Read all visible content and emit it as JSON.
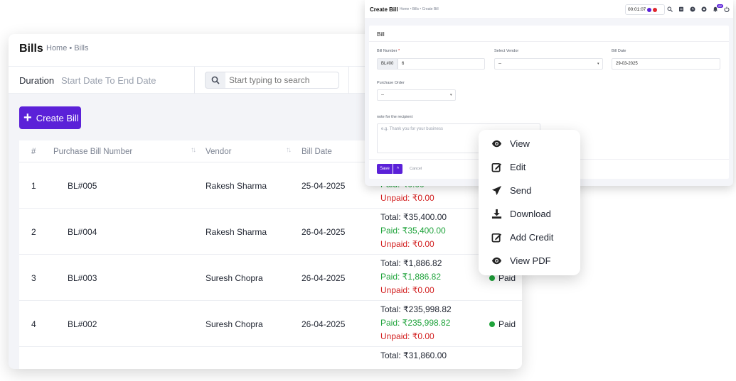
{
  "bills_page": {
    "title": "Bills",
    "breadcrumb": "Home • Bills",
    "duration_label": "Duration",
    "duration_placeholder": "Start Date To End Date",
    "search_placeholder": "Start typing to search",
    "create_button": "Create Bill",
    "columns": [
      "#",
      "Purchase Bill Number",
      "Vendor",
      "Bill Date"
    ],
    "rows": [
      {
        "num": "1",
        "bill": "BL#005",
        "vendor": "Rakesh Sharma",
        "date": "25-04-2025",
        "total": "",
        "paid": "Paid: ₹0.00",
        "unpaid": "Unpaid: ₹0.00",
        "status": ""
      },
      {
        "num": "2",
        "bill": "BL#004",
        "vendor": "Rakesh Sharma",
        "date": "26-04-2025",
        "total": "Total: ₹35,400.00",
        "paid": "Paid: ₹35,400.00",
        "unpaid": "Unpaid: ₹0.00",
        "status": ""
      },
      {
        "num": "3",
        "bill": "BL#003",
        "vendor": "Suresh Chopra",
        "date": "26-04-2025",
        "total": "Total: ₹1,886.82",
        "paid": "Paid: ₹1,886.82",
        "unpaid": "Unpaid: ₹0.00",
        "status": "Paid"
      },
      {
        "num": "4",
        "bill": "BL#002",
        "vendor": "Suresh Chopra",
        "date": "26-04-2025",
        "total": "Total: ₹235,998.82",
        "paid": "Paid: ₹235,998.82",
        "unpaid": "Unpaid: ₹0.00",
        "status": "Paid"
      },
      {
        "num": "",
        "bill": "",
        "vendor": "",
        "date": "",
        "total": "Total: ₹31,860.00",
        "paid": "",
        "unpaid": "",
        "status": ""
      }
    ]
  },
  "create_bill": {
    "title": "Create Bill",
    "breadcrumb": "Home • Bills • Create Bill",
    "timer": "00:01:07",
    "notification_count": "22",
    "section_title": "Bill",
    "bill_number_label": "Bill Number",
    "bill_number_prefix": "BL#00",
    "bill_number_value": "6",
    "vendor_label": "Select Vendor",
    "vendor_value": "--",
    "bill_date_label": "Bill Date",
    "bill_date_value": "29-03-2025",
    "po_label": "Purchase Order",
    "po_value": "--",
    "note_label": "note for the recipient",
    "note_placeholder": "e.g. Thank you for your business",
    "save_label": "Save",
    "cancel_label": "Cancel"
  },
  "menu": {
    "items": [
      "View",
      "Edit",
      "Send",
      "Download",
      "Add Credit",
      "View PDF"
    ]
  },
  "colors": {
    "accent": "#5b21d8",
    "paid": "#1fa33b",
    "unpaid": "#d21f1f"
  }
}
